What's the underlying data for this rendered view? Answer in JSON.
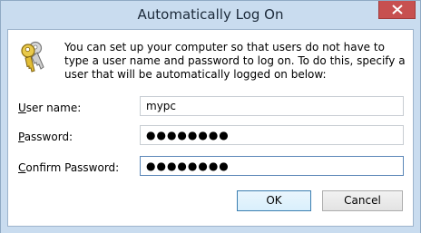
{
  "window": {
    "title": "Automatically Log On"
  },
  "icons": {
    "title_close": "close-icon",
    "dialog": "keys-icon"
  },
  "message": "You can set up your computer so that users do not have to type a user name and password to log on. To do this, specify a user that will be automatically logged on below:",
  "fields": {
    "username": {
      "label_underlined": "U",
      "label_rest": "ser name:",
      "value": "mypc"
    },
    "password": {
      "label_underlined": "P",
      "label_rest": "assword:",
      "value": "●●●●●●●●"
    },
    "confirm": {
      "label_underlined": "C",
      "label_rest": "onfirm Password:",
      "value": "●●●●●●●●"
    }
  },
  "buttons": {
    "ok": "OK",
    "cancel": "Cancel"
  },
  "colors": {
    "frame": "#c9dcef",
    "close_button": "#c75050",
    "focus_border": "#5b87b8"
  }
}
